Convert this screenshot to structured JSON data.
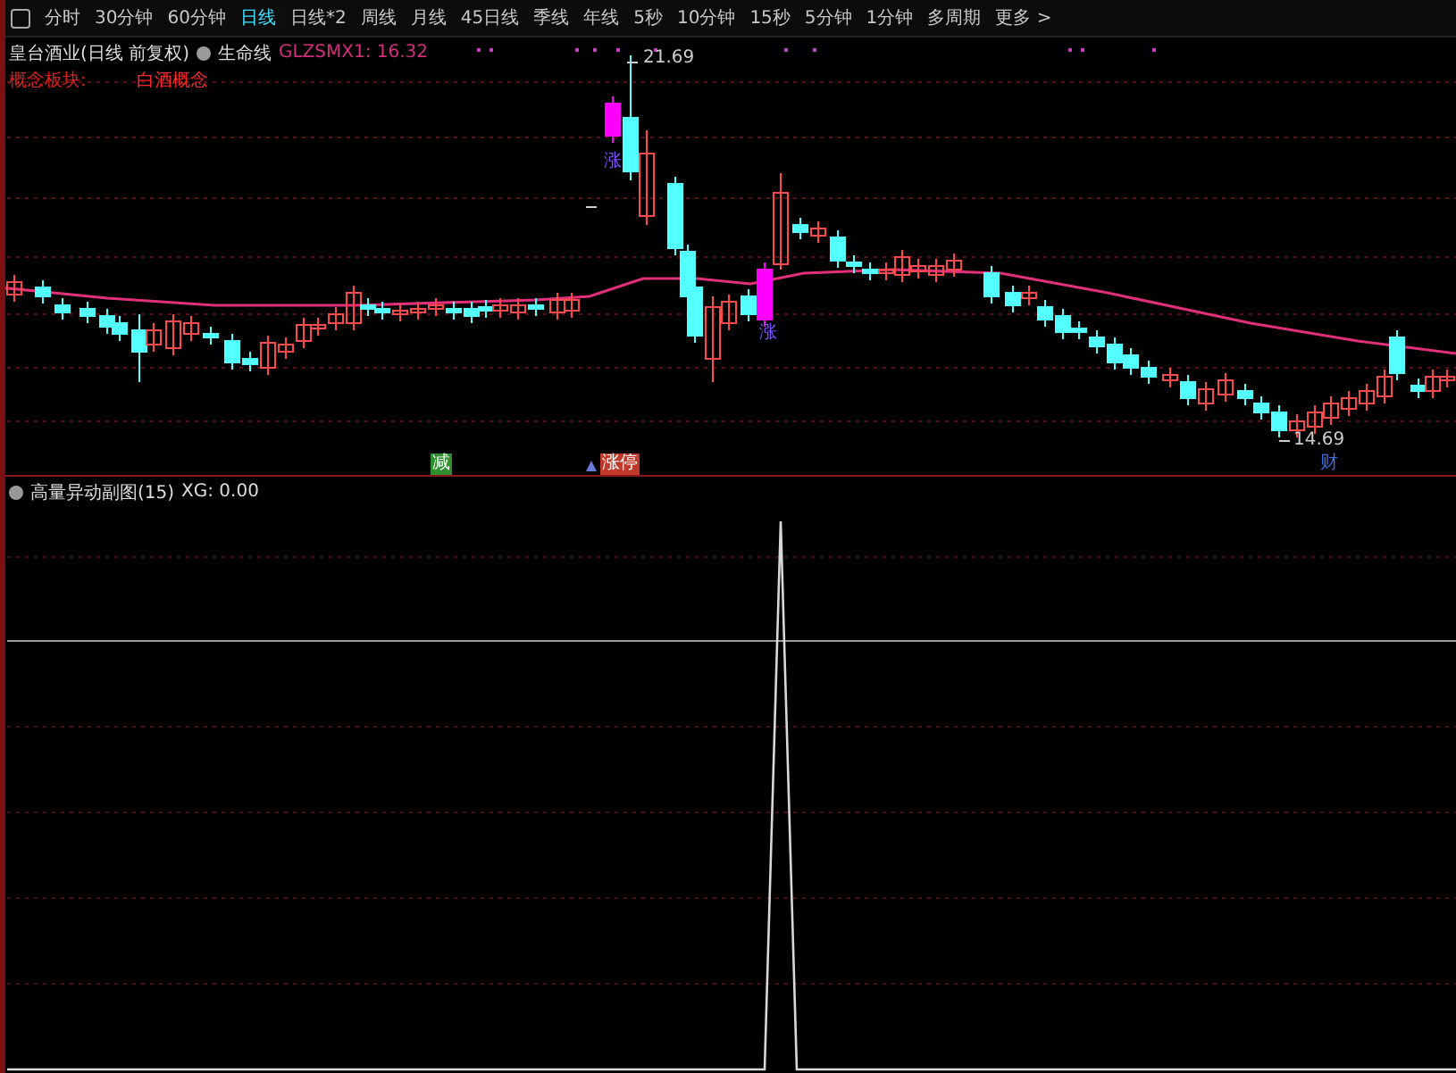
{
  "toolbar": {
    "tabs": [
      {
        "label": "分时",
        "selected": false
      },
      {
        "label": "30分钟",
        "selected": false
      },
      {
        "label": "60分钟",
        "selected": false
      },
      {
        "label": "日线",
        "selected": true
      },
      {
        "label": "日线*2",
        "selected": false
      },
      {
        "label": "周线",
        "selected": false
      },
      {
        "label": "月线",
        "selected": false
      },
      {
        "label": "45日线",
        "selected": false
      },
      {
        "label": "季线",
        "selected": false
      },
      {
        "label": "年线",
        "selected": false
      },
      {
        "label": "5秒",
        "selected": false
      },
      {
        "label": "10分钟",
        "selected": false
      },
      {
        "label": "15秒",
        "selected": false
      },
      {
        "label": "5分钟",
        "selected": false
      },
      {
        "label": "1分钟",
        "selected": false
      },
      {
        "label": "多周期",
        "selected": false
      },
      {
        "label": "更多 >",
        "selected": false
      }
    ]
  },
  "main_chart": {
    "title": "皇台酒业(日线 前复权)",
    "indicator": "生命线",
    "reading": "GLZSMX1: 16.32",
    "concept_label": "概念板块:",
    "concept_value": "白酒概念",
    "high_label": "21.69",
    "low_label": "14.69",
    "signals": [
      {
        "text": "涨"
      },
      {
        "text": "涨"
      }
    ],
    "tags": [
      {
        "text": "减",
        "color": "#2f8f2f"
      },
      {
        "text": "涨停",
        "color": "#c0392b"
      },
      {
        "text": "财",
        "color": "#3b6fd6"
      }
    ]
  },
  "sub_chart": {
    "title": "高量异动副图(15)",
    "reading": "XG: 0.00"
  }
}
